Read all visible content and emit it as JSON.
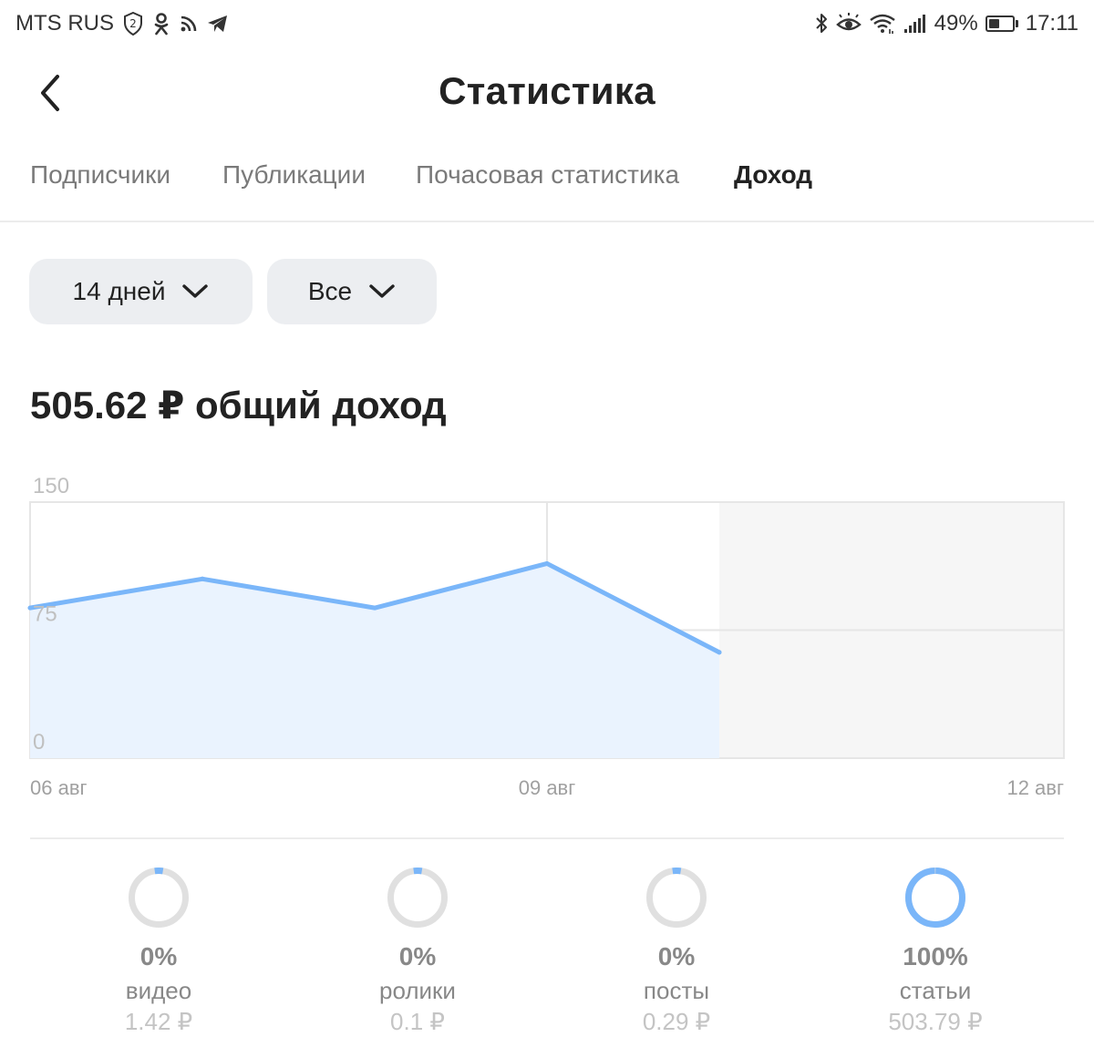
{
  "status_bar": {
    "carrier": "MTS RUS",
    "sim_badge": "2",
    "battery_text": "49%",
    "battery_level": 0.49,
    "time": "17:11"
  },
  "header": {
    "title": "Статистика"
  },
  "tabs": [
    {
      "label": "Подписчики",
      "active": false
    },
    {
      "label": "Публикации",
      "active": false
    },
    {
      "label": "Почасовая статистика",
      "active": false
    },
    {
      "label": "Доход",
      "active": true
    }
  ],
  "filters": {
    "period": "14 дней",
    "type": "Все"
  },
  "summary": {
    "total": "505.62 ₽ общий доход"
  },
  "chart_data": {
    "type": "area",
    "x": [
      "06 авг",
      "07 авг",
      "08 авг",
      "09 авг",
      "10 авг"
    ],
    "values": [
      88,
      105,
      88,
      114,
      62
    ],
    "x_ticks": [
      "06 авг",
      "09 авг",
      "12 авг"
    ],
    "x_domain": [
      "06 авг",
      "12 авг"
    ],
    "y_ticks": [
      "150",
      "75",
      "0"
    ],
    "ylim": [
      0,
      150
    ],
    "grid": true,
    "colors": {
      "line": "#7ab6f9",
      "fill": "#eaf3fe",
      "empty_zone": "#f6f6f6"
    }
  },
  "breakdown": [
    {
      "percent": "0%",
      "label": "видео",
      "amount": "1.42 ₽",
      "share": 0.0028
    },
    {
      "percent": "0%",
      "label": "ролики",
      "amount": "0.1 ₽",
      "share": 0.0002
    },
    {
      "percent": "0%",
      "label": "посты",
      "amount": "0.29 ₽",
      "share": 0.0006
    },
    {
      "percent": "100%",
      "label": "статьи",
      "amount": "503.79 ₽",
      "share": 0.9964
    }
  ],
  "colors": {
    "accent": "#7ab6f9",
    "ring_track": "#e0e0e0",
    "filter_bg": "#eceef1"
  }
}
